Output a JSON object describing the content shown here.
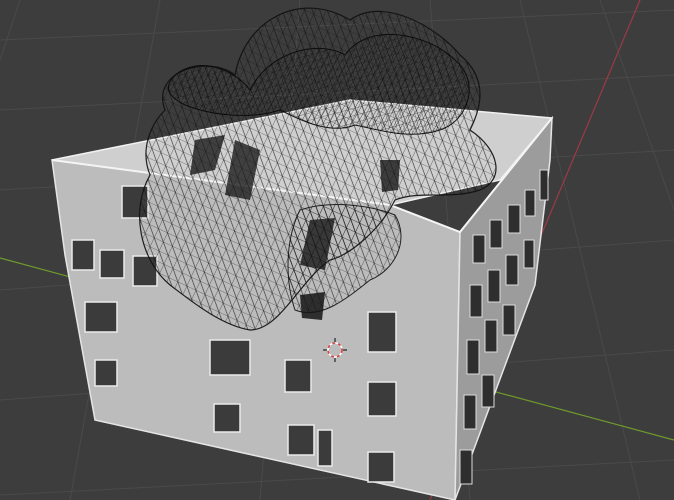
{
  "viewport": {
    "background_color": "#3d3d3d",
    "grid_color": "#494949",
    "x_axis_color": "#9c3a45",
    "y_axis_color": "#6f9a2b"
  },
  "scene": {
    "building": {
      "face_color": "#bdbdbd",
      "top_color": "#cfcfcf",
      "side_color": "#9a9a9a",
      "window_color": "#3b3b3b"
    },
    "wireframe_mesh": {
      "line_color": "#111111"
    },
    "cursor_3d": {
      "icon": "3d-cursor-icon",
      "colors": [
        "#e04040",
        "#ffffff"
      ]
    }
  }
}
